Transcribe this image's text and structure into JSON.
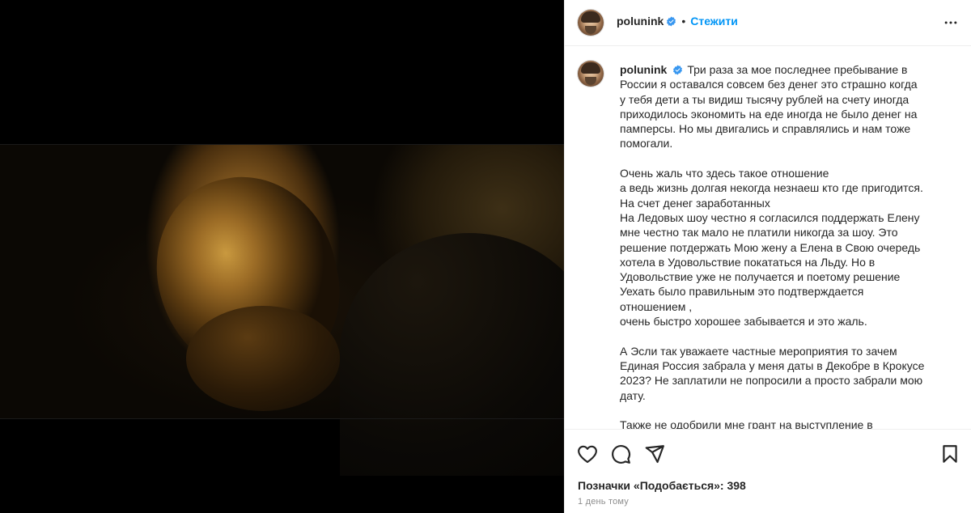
{
  "post": {
    "username": "polunink",
    "follow_label": "Стежити",
    "dot": "•",
    "caption_username": "polunink",
    "caption_text": "Три раза за мое последнее пребывание в\nРоссии я оставался совсем без денег это страшно когда\nу тебя дети а ты видиш тысячу рублей на счету иногда\nприходилось экономить на еде иногда не было денег на\nпамперсы. Но мы двигались и справлялись и нам тоже\nпомогали.\n\nОчень жаль что здесь такое отношение\nа ведь жизнь долгая некогда незнаеш кто где пригодится.\nНа счет денег заработанных\nНа Ледовых шоу честно я согласился поддержать Елену\nмне честно так мало не платили никогда за шоу. Это\nрешение потдержать Мою жену а Елена в Свою очередь\nхотела в Удовольствие покататься на Льду. Но в\nУдовольствие уже не получается и поетому решение\nУехать было правильным это подтверждается\nотношением ,\nочень быстро хорошее забывается и это жаль.\n\nА Эсли так уважаете частные мероприятия то зачем\nЕдиная Россия забрала у меня даты в Декобре в Крокусе\n2023? Не заплатили не попросили а просто забрали мою\nдату.\n\nТакже не одобрили мне грант на выступление в",
    "likes_text": "Позначки «Подобається»: 398",
    "time_text": "1 день тому"
  },
  "icons": {
    "verified": "verified-badge-icon",
    "more": "more-options-icon",
    "like": "heart-icon",
    "comment": "comment-icon",
    "share": "share-icon",
    "save": "bookmark-icon"
  },
  "colors": {
    "accent": "#0095f6",
    "text": "#262626",
    "muted": "#8e8e8e",
    "border": "#efefef",
    "media_bg": "#000000"
  }
}
